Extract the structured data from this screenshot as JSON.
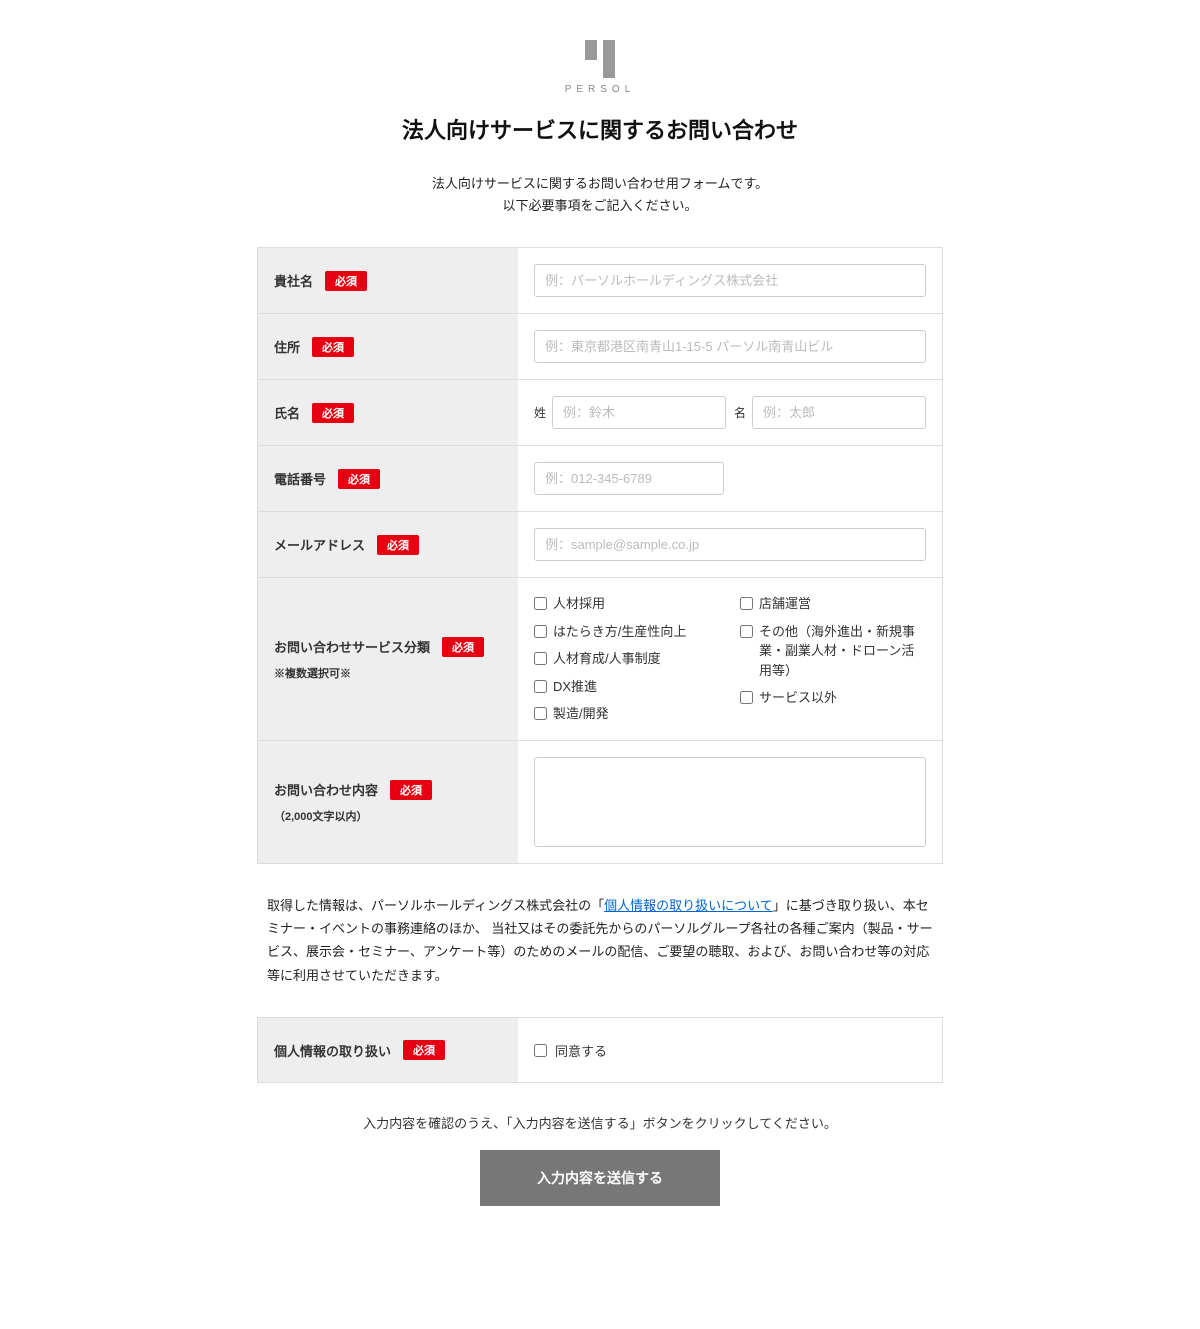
{
  "logo": {
    "text": "PERSOL"
  },
  "page_title": "法人向けサービスに関するお問い合わせ",
  "subtitle_line1": "法人向けサービスに関するお問い合わせ用フォームです。",
  "subtitle_line2": "以下必要事項をご記入ください。",
  "required_label": "必須",
  "fields": {
    "company": {
      "label": "貴社名",
      "placeholder": "例：パーソルホールディングス株式会社"
    },
    "address": {
      "label": "住所",
      "placeholder": "例：東京都港区南青山1-15-5 パーソル南青山ビル"
    },
    "name": {
      "label": "氏名",
      "sei_label": "姓",
      "sei_placeholder": "例：鈴木",
      "mei_label": "名",
      "mei_placeholder": "例：太郎"
    },
    "phone": {
      "label": "電話番号",
      "placeholder": "例：012-345-6789"
    },
    "email": {
      "label": "メールアドレス",
      "placeholder": "例：sample@sample.co.jp"
    },
    "category": {
      "label": "お問い合わせサービス分類",
      "note": "※複数選択可※",
      "col1": [
        "人材採用",
        "はたらき方/生産性向上",
        "人材育成/人事制度",
        "DX推進",
        "製造/開発"
      ],
      "col2": [
        "店舗運営",
        "その他（海外進出・新規事業・副業人材・ドローン活用等）",
        "サービス以外"
      ]
    },
    "inquiry": {
      "label": "お問い合わせ内容",
      "note": "（2,000文字以内）"
    },
    "consent": {
      "label": "個人情報の取り扱い",
      "checkbox_label": "同意する"
    }
  },
  "policy": {
    "pre": "取得した情報は、パーソルホールディングス株式会社の「",
    "link": "個人情報の取り扱いについて",
    "post": "」に基づき取り扱い、本セミナー・イベントの事務連絡のほか、 当社又はその委託先からのパーソルグループ各社の各種ご案内（製品・サービス、展示会・セミナー、アンケート等）のためのメールの配信、ご要望の聴取、および、お問い合わせ等の対応等に利用させていただきます。"
  },
  "instruction": "入力内容を確認のうえ、「入力内容を送信する」ボタンをクリックしてください。",
  "submit_label": "入力内容を送信する"
}
